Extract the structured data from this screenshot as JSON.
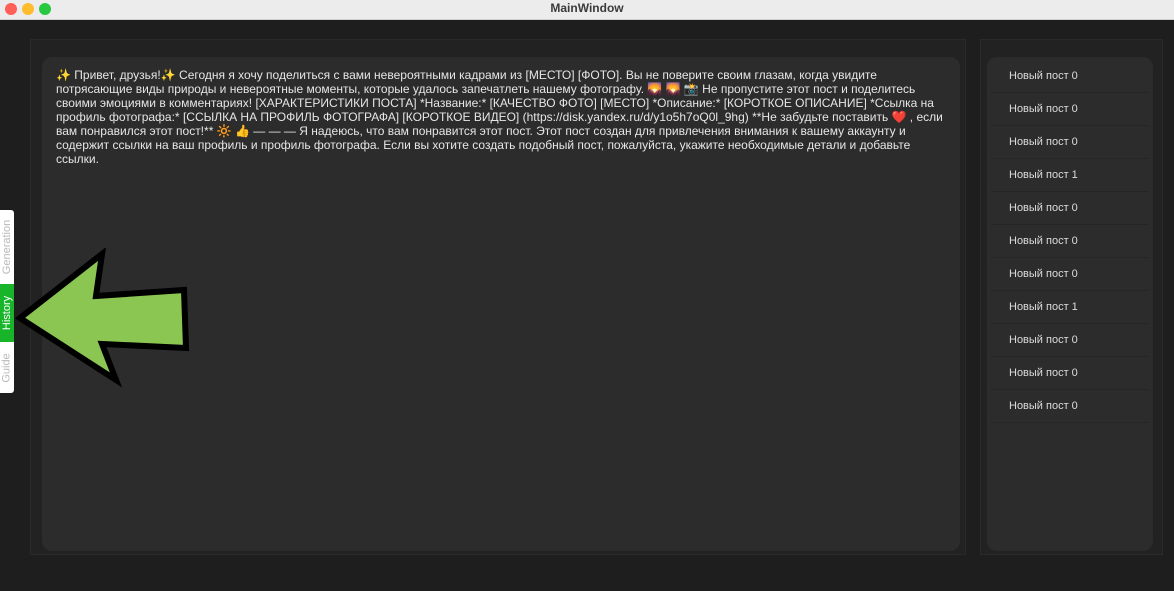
{
  "window": {
    "title": "MainWindow"
  },
  "tabs": [
    {
      "label": "Generation",
      "active": false
    },
    {
      "label": "History",
      "active": true
    },
    {
      "label": "Guide",
      "active": false
    }
  ],
  "post": {
    "text": "✨ Привет, друзья!✨  Сегодня я хочу поделиться с вами невероятными кадрами из [МЕСТО] [ФОТО]. Вы не поверите своим глазам, когда увидите потрясающие виды природы и невероятные моменты, которые удалось запечатлеть нашему фотографу. 🌄 🌄 📸  Не пропустите этот пост и поделитесь своими эмоциями в комментариях! [ХАРАКТЕРИСТИКИ ПОСТА] *Название:* [КАЧЕСТВО ФОТО] [МЕСТО] *Описание:* [КОРОТКОЕ ОПИСАНИЕ] *Ссылка на профиль фотографа:* [ССЫЛКА НА ПРОФИЛЬ ФОТОГРАФА] [КОРОТКОЕ ВИДЕО] (https://disk.yandex.ru/d/y1o5h7oQ0l_9hg) **Не забудьте поставить ❤️ , если вам понравился этот пост!** 🔆 👍  — — — Я надеюсь, что вам понравится этот пост. Этот пост создан для привлечения внимания к вашему аккаунту и содержит ссылки на ваш профиль и профиль фотографа. Если вы хотите создать подобный пост, пожалуйста, укажите необходимые детали и добавьте ссылки."
  },
  "history": {
    "items": [
      {
        "label": "Новый пост 0"
      },
      {
        "label": "Новый пост 0"
      },
      {
        "label": "Новый пост 0"
      },
      {
        "label": "Новый пост 1"
      },
      {
        "label": "Новый пост 0"
      },
      {
        "label": "Новый пост 0"
      },
      {
        "label": "Новый пост 0"
      },
      {
        "label": "Новый пост 1"
      },
      {
        "label": "Новый пост 0"
      },
      {
        "label": "Новый пост 0"
      },
      {
        "label": "Новый пост 0"
      }
    ]
  },
  "colors": {
    "background": "#1e1e1e",
    "panel": "#2c2c2c",
    "active_tab": "#18b52b",
    "arrow": "#8bc653"
  },
  "icons": {
    "annotation": "green-left-arrow"
  }
}
